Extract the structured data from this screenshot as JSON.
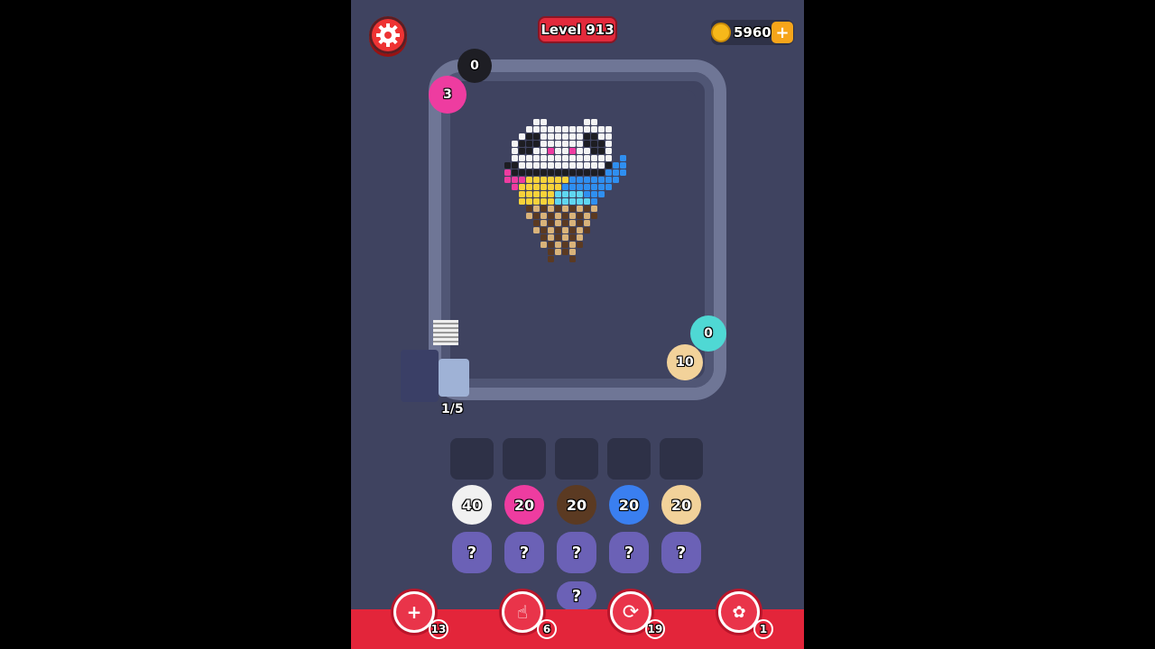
{
  "header": {
    "level_label": "Level 913",
    "coins": "5960",
    "coin_add_symbol": "+"
  },
  "track": {
    "progress": "1/5"
  },
  "track_pieces": [
    {
      "name": "black-shooter",
      "count": "0",
      "color": "#1e1e24"
    },
    {
      "name": "pink-shooter",
      "count": "3",
      "color": "#ee3ca0"
    },
    {
      "name": "cyan-shooter",
      "count": "0",
      "color": "#4fd8d4"
    },
    {
      "name": "beige-shooter",
      "count": "10",
      "color": "#f2d29a"
    }
  ],
  "queue": [
    {
      "count": "40",
      "color": "#f1f1f1"
    },
    {
      "count": "20",
      "color": "#ee3ca0"
    },
    {
      "count": "20",
      "color": "#5b3a22"
    },
    {
      "count": "20",
      "color": "#3a7ff0"
    },
    {
      "count": "20",
      "color": "#f2d29a"
    }
  ],
  "hidden_label": "?",
  "boosters": [
    {
      "name": "add-slot",
      "count": "13"
    },
    {
      "name": "hand-pick",
      "count": "6"
    },
    {
      "name": "shuffle",
      "count": "19"
    },
    {
      "name": "magnet-bunny",
      "count": "1"
    }
  ],
  "colors": {
    "background": "#3f4360",
    "accent_red": "#e3253a",
    "coin": "#f6b81a"
  }
}
